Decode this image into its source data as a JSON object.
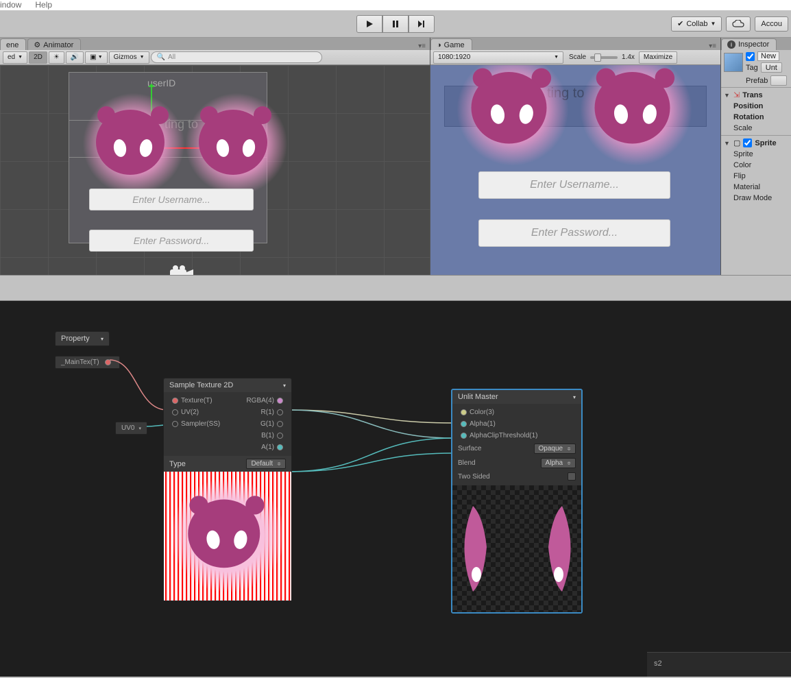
{
  "menubar": {
    "window": "indow",
    "help": "Help"
  },
  "toolbar": {
    "collab": "Collab",
    "account": "Accou"
  },
  "tabs": {
    "scene": "ene",
    "animator": "Animator",
    "game": "Game",
    "inspector": "Inspector"
  },
  "scene_toolbar": {
    "shaded": "ed",
    "twod": "2D",
    "gizmos": "Gizmos",
    "search_placeholder": "All"
  },
  "game_toolbar": {
    "aspect": "1080:1920",
    "scale_label": "Scale",
    "scale_value": "1.4x",
    "maximize": "Maximize"
  },
  "scene_content": {
    "userid": "userID",
    "connecting": "ting to",
    "username_placeholder": "Enter Username...",
    "password_placeholder": "Enter Password..."
  },
  "game_content": {
    "connecting": "ting to",
    "username_placeholder": "Enter Username...",
    "password_placeholder": "Enter Password..."
  },
  "inspector": {
    "new": "New",
    "tag_label": "Tag",
    "tag_value": "Unt",
    "prefab_label": "Prefab",
    "transform": "Trans",
    "position": "Position",
    "rotation": "Rotation",
    "scale": "Scale",
    "sprite_component": "Sprite",
    "sprite": "Sprite",
    "color": "Color",
    "flip": "Flip",
    "material": "Material",
    "draw_mode": "Draw Mode"
  },
  "shader": {
    "property_title": "Property",
    "maintex": "_MainTex(T)",
    "uv0": "UV0",
    "sample_node": {
      "title": "Sample Texture 2D",
      "texture": "Texture(T)",
      "uv": "UV(2)",
      "sampler": "Sampler(SS)",
      "rgba": "RGBA(4)",
      "r": "R(1)",
      "g": "G(1)",
      "b": "B(1)",
      "a": "A(1)",
      "type_label": "Type",
      "type_value": "Default"
    },
    "master_node": {
      "title": "Unlit Master",
      "color": "Color(3)",
      "alpha": "Alpha(1)",
      "alphaclip": "AlphaClipThreshold(1)",
      "surface_label": "Surface",
      "surface_value": "Opaque",
      "blend_label": "Blend",
      "blend_value": "Alpha",
      "twosided_label": "Two Sided"
    },
    "status": "s2"
  }
}
